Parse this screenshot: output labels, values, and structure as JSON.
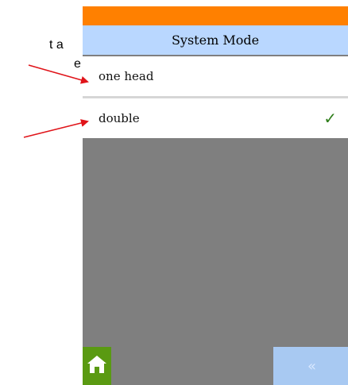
{
  "annotations": {
    "line1_fragment": "t a",
    "line2_fragment": "e"
  },
  "screen": {
    "title": "System Mode",
    "options": [
      {
        "label": "one head",
        "selected": false
      },
      {
        "label": "double",
        "selected": true
      }
    ],
    "selected_mark": "✓",
    "back_glyph": "«",
    "colors": {
      "top_bar": "#ff8000",
      "title_bar": "#b9d7ff",
      "body": "#7f7f7f",
      "home_button": "#5a9a12",
      "back_button": "#a8c9f2",
      "checkmark": "#2e7d1a",
      "annotation_arrow": "#e0141a"
    },
    "icons": {
      "home": "home-icon",
      "back": "double-chevron-left-icon",
      "check": "checkmark-icon"
    }
  }
}
